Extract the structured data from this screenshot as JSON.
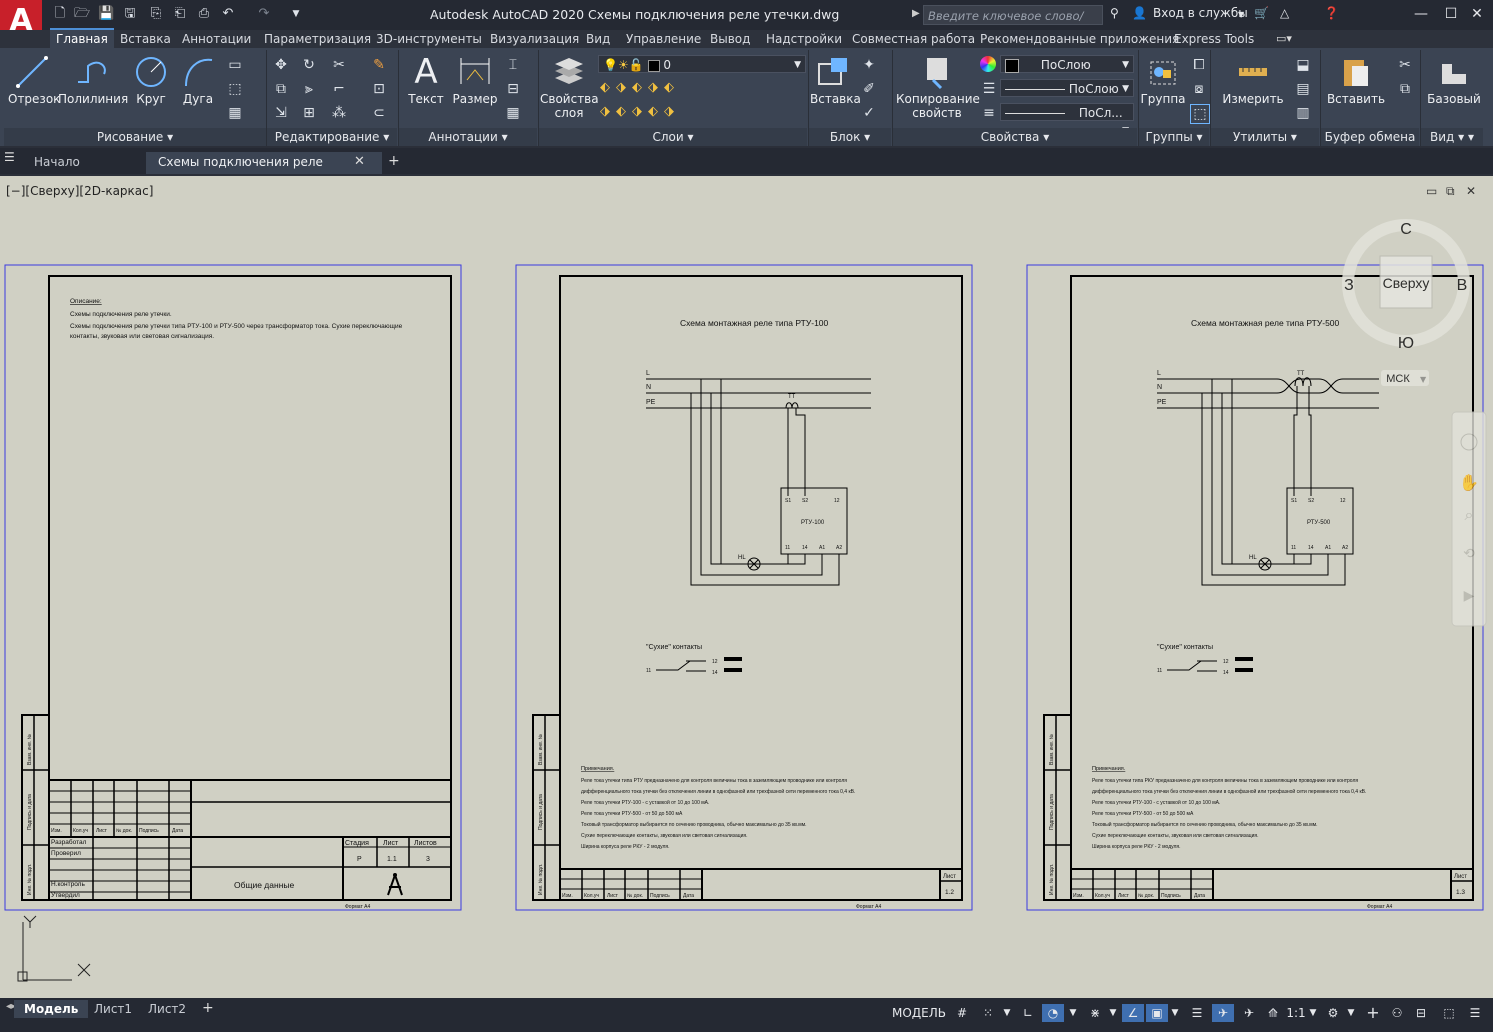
{
  "title_bar": {
    "title": "Autodesk AutoCAD 2020   Схемы подключения реле утечки.dwg",
    "search_placeholder": "Введите ключевое слово/фразу",
    "sign_in": "Вход в службы"
  },
  "ribbon_tabs": [
    "Главная",
    "Вставка",
    "Аннотации",
    "Параметризация",
    "3D-инструменты",
    "Визуализация",
    "Вид",
    "Управление",
    "Вывод",
    "Надстройки",
    "Совместная работа",
    "Рекомендованные приложения",
    "Express Tools"
  ],
  "ribbon": {
    "draw": {
      "line": "Отрезок",
      "polyline": "Полилиния",
      "circle": "Круг",
      "arc": "Дуга",
      "title": "Рисование"
    },
    "modify": {
      "title": "Редактирование"
    },
    "annotation": {
      "text": "Текст",
      "dimension": "Размер",
      "title": "Аннотации"
    },
    "layers": {
      "props1": "Свойства",
      "props2": "слоя",
      "current_layer": "0",
      "title": "Слои"
    },
    "block": {
      "insert": "Вставка",
      "title": "Блок"
    },
    "properties": {
      "copy1": "Копирование",
      "copy2": "свойств",
      "color": "ПоСлою",
      "linetype": "ПоСлою",
      "lineweight": "ПоСл...",
      "title": "Свойства"
    },
    "groups": {
      "group": "Группа",
      "title": "Группы"
    },
    "utilities": {
      "measure": "Измерить",
      "title": "Утилиты"
    },
    "clipboard": {
      "paste": "Вставить",
      "title": "Буфер обмена"
    },
    "view": {
      "base": "Базовый",
      "title": "Вид"
    }
  },
  "doc_tabs": {
    "start": "Начало",
    "current": "Схемы подключения реле утечки*"
  },
  "viewport_label": "[−][Сверху][2D-каркас]",
  "viewcube": {
    "top": "Сверху",
    "n": "С",
    "s": "Ю",
    "w": "З",
    "e": "В",
    "ucs": "МСК"
  },
  "sheet1": {
    "desc_title": "Описание:",
    "desc_line1": "Схемы подключения реле утечки.",
    "desc_line2": "Схемы подключения реле утечки типа РТУ-100 и РТУ-500 через трансформатор тока. Сухие переключающие",
    "desc_line3": "контакты, звуковая или световая сигнализация.",
    "stage_h": "Стадия",
    "sheet_h": "Лист",
    "sheets_h": "Листов",
    "stage": "Р",
    "sheet": "1.1",
    "sheets": "3",
    "name": "Общие данные",
    "dev": "Разработал",
    "check": "Проверил",
    "nc": "Н.контроль",
    "appr": "Утвердил",
    "cols": [
      "Изм.",
      "Кол.уч",
      "Лист",
      "№ док.",
      "Подпись",
      "Дата"
    ],
    "format": "Формат А4"
  },
  "sheet2": {
    "title": "Схема монтажная реле типа РТУ-100",
    "relay": "РТУ-100",
    "sheet": "1.2"
  },
  "sheet3": {
    "title": "Схема монтажная реле типа РТУ-500",
    "relay": "РТУ-500",
    "sheet": "1.3"
  },
  "schematic": {
    "L": "L",
    "N": "N",
    "PE": "PE",
    "TT": "ТТ",
    "HL": "HL",
    "terms_top": [
      "S1",
      "S2",
      "12"
    ],
    "terms_bot": [
      "11",
      "14",
      "A1",
      "A2"
    ],
    "dry": "\"Сухие\" контакты",
    "c11": "11",
    "c12": "12",
    "c14": "14",
    "notes_title": "Примечания.",
    "notes2": [
      "Реле тока утечки типа РТУ предназначено для контроля величины тока в заземляющем проводнике или контроля",
      "дифференциального тока утечки без отключения линии в однофазной или трехфазной сети переменного тока 0,4 кВ.",
      "Реле тока утечки РТУ-100 - с уставкой от 10 до 100 мА.",
      "Реле тока утечки РТУ-500 - от 50 до 500 мА",
      "Токовый трансформатор выбирается по сечению проводника, обычно максимально до 35 кв.мм.",
      "Сухие переключающие контакты, звуковая или световая сигнализация.",
      "Ширина корпуса реле РКУ - 2 модуля."
    ],
    "notes3": [
      "Реле тока утечки типа РКУ предназначено для контроля величины тока в заземляющем проводнике или контроля",
      "дифференциального тока утечки без отключения линии в однофазной или трехфазной сети переменного тока 0,4 кВ.",
      "Реле тока утечки РТУ-100 - с уставкой от 10 до 100 мА.",
      "Реле тока утечки РТУ-500 - от 50 до 500 мА",
      "Токовый трансформатор выбирается по сечению проводника, обычно максимально до 35 кв.мм.",
      "Сухие переключающие контакты, звуковая или световая сигнализация.",
      "Ширина корпуса реле РКУ - 2 модуля."
    ],
    "sheet_label": "Лист",
    "side_labels": [
      "Взам. инв. №",
      "Подпись и дата",
      "Инв. № подл."
    ]
  },
  "layout_tabs": [
    "Модель",
    "Лист1",
    "Лист2"
  ],
  "status": {
    "model": "МОДЕЛЬ",
    "scale": "1:1"
  }
}
